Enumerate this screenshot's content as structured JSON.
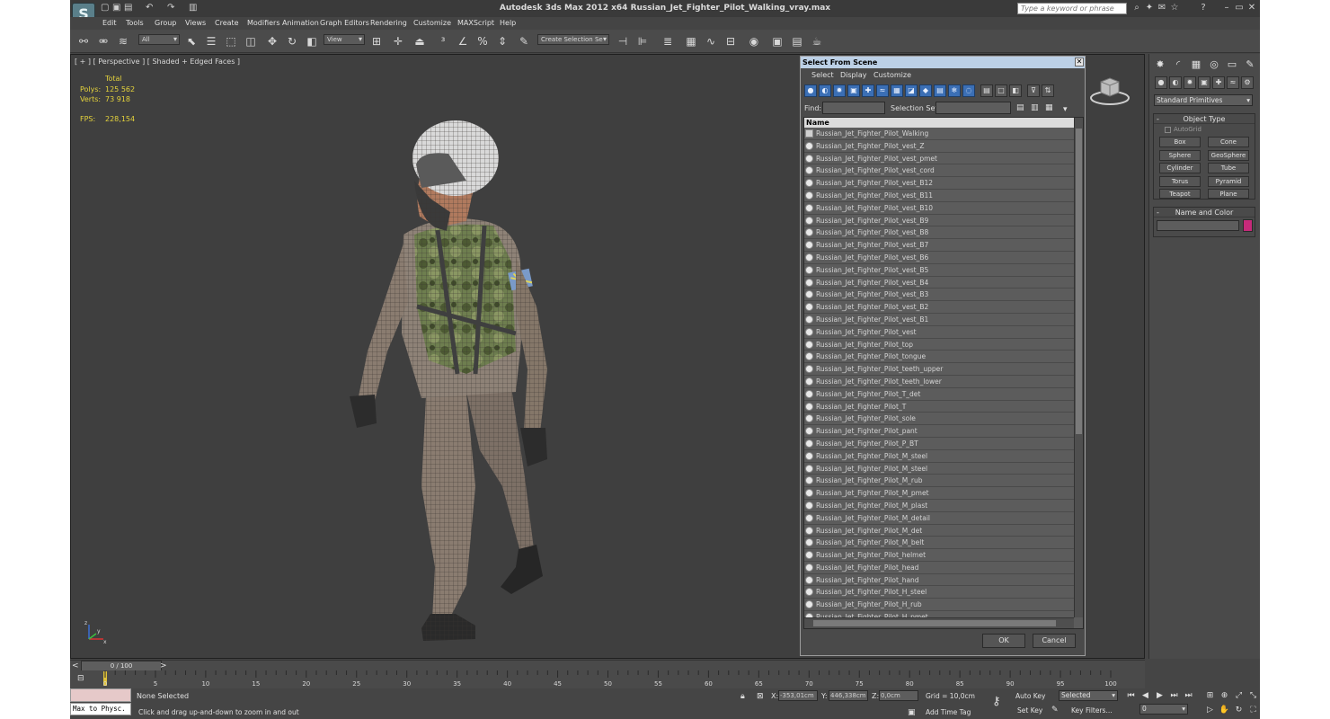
{
  "window": {
    "title": "Autodesk 3ds Max  2012 x64     Russian_Jet_Fighter_Pilot_Walking_vray.max",
    "search_placeholder": "Type a keyword or phrase",
    "logo_glyph": "S"
  },
  "menu": [
    "Edit",
    "Tools",
    "Group",
    "Views",
    "Create",
    "Modifiers",
    "Animation",
    "Graph Editors",
    "Rendering",
    "Customize",
    "MAXScript",
    "Help"
  ],
  "toolbar": {
    "filter_value": "All",
    "ref_coord_value": "View",
    "selection_set_placeholder": "Create Selection Se"
  },
  "viewport": {
    "label": "[ + ] [ Perspective ] [ Shaded + Edged Faces ]",
    "stats": {
      "total_label": "Total",
      "polys_label": "Polys:",
      "polys_value": "125 562",
      "verts_label": "Verts:",
      "verts_value": "73 918",
      "fps_label": "FPS:",
      "fps_value": "228,154"
    },
    "axis_labels": {
      "x": "x",
      "y": "y",
      "z": "z"
    }
  },
  "dialog": {
    "title": "Select From Scene",
    "menu": [
      "Select",
      "Display",
      "Customize"
    ],
    "find_label": "Find:",
    "selection_set_label": "Selection Set:",
    "column_name": "Name",
    "ok_label": "OK",
    "cancel_label": "Cancel",
    "items": [
      "Russian_Jet_Fighter_Pilot_Walking",
      "Russian_Jet_Fighter_Pilot_vest_Z",
      "Russian_Jet_Fighter_Pilot_vest_pmet",
      "Russian_Jet_Fighter_Pilot_vest_cord",
      "Russian_Jet_Fighter_Pilot_vest_B12",
      "Russian_Jet_Fighter_Pilot_vest_B11",
      "Russian_Jet_Fighter_Pilot_vest_B10",
      "Russian_Jet_Fighter_Pilot_vest_B9",
      "Russian_Jet_Fighter_Pilot_vest_B8",
      "Russian_Jet_Fighter_Pilot_vest_B7",
      "Russian_Jet_Fighter_Pilot_vest_B6",
      "Russian_Jet_Fighter_Pilot_vest_B5",
      "Russian_Jet_Fighter_Pilot_vest_B4",
      "Russian_Jet_Fighter_Pilot_vest_B3",
      "Russian_Jet_Fighter_Pilot_vest_B2",
      "Russian_Jet_Fighter_Pilot_vest_B1",
      "Russian_Jet_Fighter_Pilot_vest",
      "Russian_Jet_Fighter_Pilot_top",
      "Russian_Jet_Fighter_Pilot_tongue",
      "Russian_Jet_Fighter_Pilot_teeth_upper",
      "Russian_Jet_Fighter_Pilot_teeth_lower",
      "Russian_Jet_Fighter_Pilot_T_det",
      "Russian_Jet_Fighter_Pilot_T",
      "Russian_Jet_Fighter_Pilot_sole",
      "Russian_Jet_Fighter_Pilot_pant",
      "Russian_Jet_Fighter_Pilot_P_BT",
      "Russian_Jet_Fighter_Pilot_M_steel",
      "Russian_Jet_Fighter_Pilot_M_steel",
      "Russian_Jet_Fighter_Pilot_M_rub",
      "Russian_Jet_Fighter_Pilot_M_pmet",
      "Russian_Jet_Fighter_Pilot_M_plast",
      "Russian_Jet_Fighter_Pilot_M_detail",
      "Russian_Jet_Fighter_Pilot_M_det",
      "Russian_Jet_Fighter_Pilot_M_belt",
      "Russian_Jet_Fighter_Pilot_helmet",
      "Russian_Jet_Fighter_Pilot_head",
      "Russian_Jet_Fighter_Pilot_hand",
      "Russian_Jet_Fighter_Pilot_H_steel",
      "Russian_Jet_Fighter_Pilot_H_rub",
      "Russian_Jet_Fighter_Pilot_H_pmet"
    ]
  },
  "command_panel": {
    "primitive_dropdown": "Standard Primitives",
    "object_type_title": "Object Type",
    "autogrid_label": "AutoGrid",
    "buttons": [
      "Box",
      "Cone",
      "Sphere",
      "GeoSphere",
      "Cylinder",
      "Tube",
      "Torus",
      "Pyramid",
      "Teapot",
      "Plane"
    ],
    "name_color_title": "Name and Color",
    "color": "#c62a7a"
  },
  "timeline": {
    "slider_label": "0 / 100",
    "ticks": [
      "0",
      "5",
      "10",
      "15",
      "20",
      "25",
      "30",
      "35",
      "40",
      "45",
      "50",
      "55",
      "60",
      "65",
      "70",
      "75",
      "80",
      "85",
      "90",
      "95",
      "100"
    ]
  },
  "status": {
    "maxscript_value": "Max to Physc.",
    "selection_text": "None Selected",
    "prompt_text": "Click and drag up-and-down to zoom in and out",
    "x_label": "X:",
    "x_value": "-353,01cm",
    "y_label": "Y:",
    "y_value": "446,338cm",
    "z_label": "Z:",
    "z_value": "0,0cm",
    "grid_text": "Grid = 10,0cm",
    "add_time_tag": "Add Time Tag",
    "auto_key": "Auto Key",
    "set_key": "Set Key",
    "key_mode_value": "Selected",
    "key_filters": "Key Filters...",
    "frame_value": "0"
  }
}
